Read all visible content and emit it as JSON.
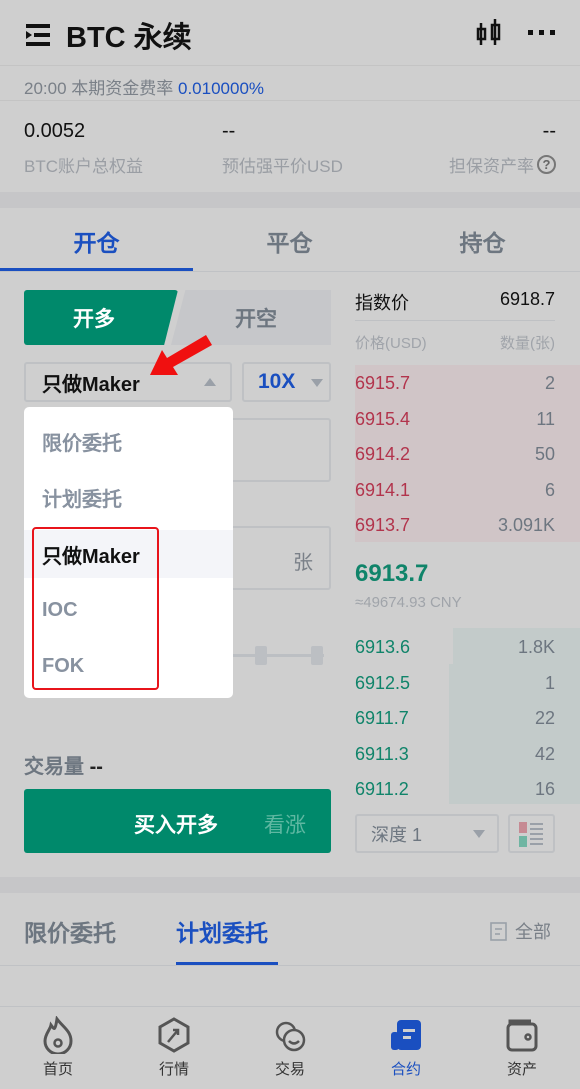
{
  "header": {
    "title": "BTC 永续",
    "menu_icon": "menu-expand-icon",
    "chart_icon": "candlestick-icon",
    "more_icon": "more-icon"
  },
  "funding": {
    "label": "20:00 本期资金费率",
    "rate": "0.010000%"
  },
  "stats": [
    {
      "value": "0.0052",
      "label": "BTC账户总权益"
    },
    {
      "value": "--",
      "label": "预估强平价USD"
    },
    {
      "value": "--",
      "label": "担保资产率"
    }
  ],
  "tabs": [
    {
      "label": "开仓",
      "active": true
    },
    {
      "label": "平仓"
    },
    {
      "label": "持仓"
    }
  ],
  "trade": {
    "long_label": "开多",
    "short_label": "开空",
    "order_type": "只做Maker",
    "leverage": "10X",
    "amount_unit": "张",
    "volume_label": "交易量",
    "volume_value": "--",
    "buy_label": "买入开多",
    "buy_sub": "看涨"
  },
  "dropdown": {
    "options": [
      "限价委托",
      "计划委托",
      "只做Maker",
      "IOC",
      "FOK"
    ],
    "selected": "只做Maker"
  },
  "orderbook": {
    "index_label": "指数价",
    "index_value": "6918.7",
    "price_header": "价格(USD)",
    "qty_header": "数量(张)",
    "asks": [
      [
        "6915.7",
        "2"
      ],
      [
        "6915.4",
        "11"
      ],
      [
        "6914.2",
        "50"
      ],
      [
        "6914.1",
        "6"
      ],
      [
        "6913.7",
        "3.091K"
      ]
    ],
    "last_price": "6913.7",
    "last_cny": "≈49674.93 CNY",
    "bids": [
      [
        "6913.6",
        "1.8K"
      ],
      [
        "6912.5",
        "1"
      ],
      [
        "6911.7",
        "22"
      ],
      [
        "6911.3",
        "42"
      ],
      [
        "6911.2",
        "16"
      ]
    ],
    "depth_label": "深度 1"
  },
  "orders": {
    "tabs": [
      {
        "label": "限价委托"
      },
      {
        "label": "计划委托",
        "active": true
      }
    ],
    "all_label": "全部"
  },
  "nav": [
    {
      "label": "首页",
      "icon": "fire-icon"
    },
    {
      "label": "行情",
      "icon": "market-icon"
    },
    {
      "label": "交易",
      "icon": "exchange-icon"
    },
    {
      "label": "合约",
      "icon": "contract-icon",
      "active": true
    },
    {
      "label": "资产",
      "icon": "wallet-icon"
    }
  ],
  "colors": {
    "accent": "#1a4fc0",
    "buy": "#00896b",
    "ask": "#b2344c",
    "annotation": "#e8141b"
  }
}
